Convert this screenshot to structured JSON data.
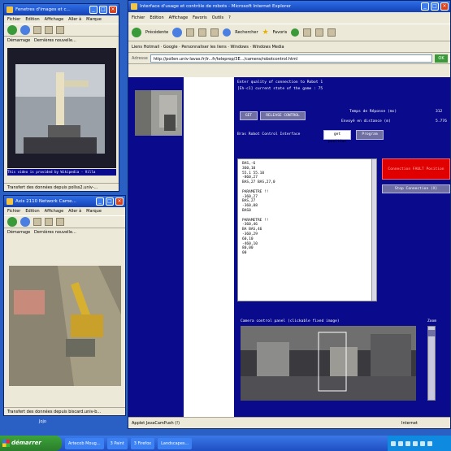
{
  "win_top": {
    "title": "Fenetres d'images et c...",
    "menu": [
      "Fichier",
      "Edition",
      "Affichage",
      "Aller à",
      "Marque"
    ],
    "links": [
      "Démarrage",
      "Dernières nouvelle..."
    ],
    "caption": "This video is provided by Wikipedia - Villa",
    "status": "Transfert des données depuis pollss2.univ-..."
  },
  "win_mid": {
    "title": "Axis 2110 Network Came...",
    "menu": [
      "Fichier",
      "Edition",
      "Affichage",
      "Aller à",
      "Marque"
    ],
    "links": [
      "Démarrage",
      "Dernières nouvelle..."
    ],
    "status": "Transfert des données depuis biscard.univ-b..."
  },
  "main_win": {
    "title": "Interface d'usage et contrôle de robots - Microsoft Internet Explorer",
    "menu": [
      "Fichier",
      "Edition",
      "Affichage",
      "Favoris",
      "Outils",
      "?"
    ],
    "toolbar": {
      "back": "Précédente",
      "search": "Rechercher",
      "favorites": "Favoris"
    },
    "links_label": "Liens",
    "links": [
      "Hotmail",
      "Google",
      "Personnaliser les liens",
      "Windows",
      "Windows Media"
    ],
    "address_label": "Adresse",
    "address": "http://pollen.univ-lavas.fr/ir...fr/teleprop/3E.../camera/robotcontrol.html",
    "go": "OK",
    "status": "Applet JavaCamPush (!)",
    "zone": "Internet"
  },
  "applet": {
    "top_lines": [
      "Enter quality of connection to Robot 1",
      "[Eh-c1] current state of the game : 75"
    ],
    "btn_get": "GET",
    "btn_release": "RELEASE CONTROL",
    "robot_label": "Bras Robot Control Interface",
    "btn_send": "get position",
    "btn_program": "Program",
    "stat1_label": "Temps de Réponse (ms)",
    "stat1_value": "312",
    "stat2_label": "Envoyé en distance (m)",
    "stat2_value": "5.776",
    "cmds": [
      "BAS,-6",
      "360,10",
      "55.1    55.10",
      "-860,27",
      "BAS,27    BAS,27,0",
      "",
      "PARAMETRE !!",
      "-360,27",
      "BAS,27",
      "-360,08",
      "BAS0",
      "",
      "PARAMETRE !!",
      "-360,46",
      "BA  BAS,46",
      "-360,29",
      "60,10",
      "-460,10",
      "80,00",
      "00"
    ],
    "alert": "Connection FAULT Position",
    "btn_stop": "Stop Connection (X)",
    "panel_label": "Camera control panel (clickable fixed image)",
    "zoom_label": "Zoom"
  },
  "taskbar": {
    "start": "démarrer",
    "buttons": [
      "Artecob Moug...",
      "3 Paint",
      "3 Firefox",
      "Landscapes..."
    ]
  },
  "desktop_label": "Jojo"
}
